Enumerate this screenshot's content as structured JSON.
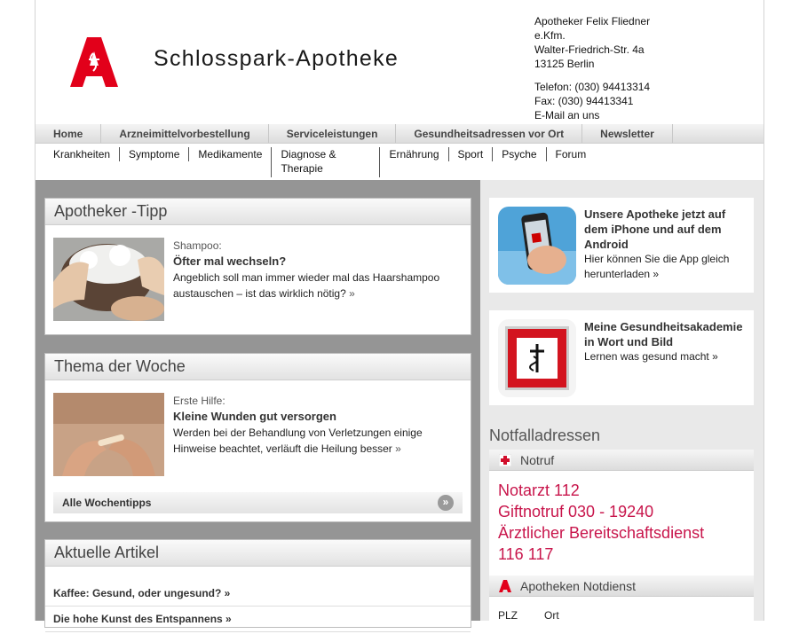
{
  "brand": {
    "name": "Schlosspark-Apotheke",
    "logo": "apotheke-a-logo",
    "accent": "#e2001a"
  },
  "address": {
    "owner": "Apotheker Felix Fliedner",
    "suffix": "e.Kfm.",
    "street": "Walter-Friedrich-Str. 4a",
    "city": "13125 Berlin",
    "phone": "Telefon: (030) 94413314",
    "fax": "Fax: (030) 94413341",
    "email": "E-Mail an uns"
  },
  "mainnav": [
    "Home",
    "Arzneimittelvorbestellung",
    "Serviceleistungen",
    "Gesundheitsadressen vor Ort",
    "Newsletter"
  ],
  "subnav": {
    "first": [
      "Krankheiten",
      "Symptome",
      "Medikamente"
    ],
    "diagnose": "Diagnose & Therapie",
    "rest": [
      "Ernährung",
      "Sport",
      "Psyche",
      "Forum"
    ]
  },
  "tipp": {
    "title": "Apotheker -Tipp",
    "kicker": "Shampoo:",
    "headline": "Öfter mal wechseln?",
    "text": "Angeblich soll man immer wieder mal das Haarshampoo austauschen – ist das wirklich nötig?",
    "more": "»"
  },
  "woche": {
    "title": "Thema der Woche",
    "kicker": "Erste Hilfe:",
    "headline": "Kleine Wunden gut versorgen",
    "text": "Werden bei der Behandlung von Verletzungen einige Hinweise beachtet, verläuft die Heilung besser",
    "more": "»",
    "all_link": "Alle Wochentipps",
    "all_icon": "»"
  },
  "artikel": {
    "title": "Aktuelle Artikel",
    "items": [
      "Kaffee: Gesund, oder ungesund? »",
      "Die hohe Kunst des Entspannens »"
    ]
  },
  "app": {
    "title": "Unsere Apotheke jetzt auf dem iPhone und auf dem Android",
    "text": "Hier können Sie die App gleich herunterladen »"
  },
  "akademie": {
    "title": "Meine Gesundheitsakademie in Wort und Bild",
    "text": "Lernen was gesund macht »"
  },
  "notfall": {
    "heading": "Notfalladressen",
    "notruf_label": "Notruf",
    "numbers": [
      "Notarzt 112",
      "Giftnotruf 030 - 19240",
      "Ärztlicher Bereitschaftsdienst",
      "116 117"
    ],
    "notdienst_label": "Apotheken Notdienst",
    "plz": "PLZ",
    "ort": "Ort"
  }
}
